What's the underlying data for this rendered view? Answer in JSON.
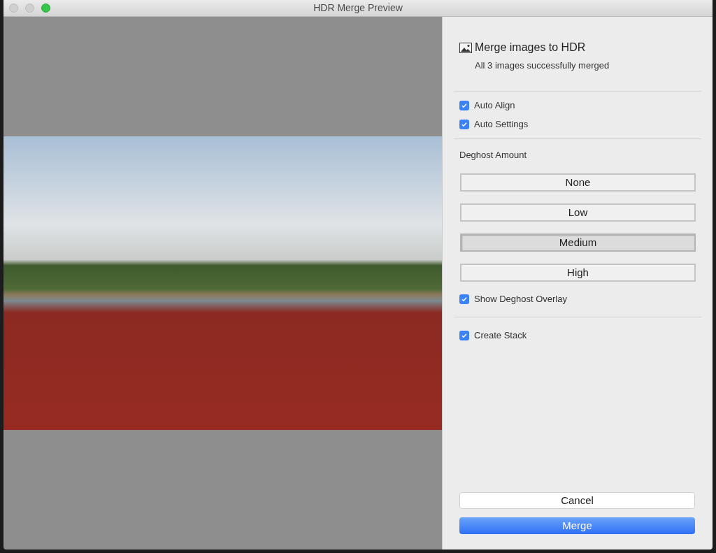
{
  "window": {
    "title": "HDR Merge Preview"
  },
  "panel": {
    "title": "Merge images to HDR",
    "subtitle": "All 3 images successfully merged",
    "align_options": [
      {
        "label": "Auto Align",
        "checked": true
      },
      {
        "label": "Auto Settings",
        "checked": true
      }
    ],
    "deghost": {
      "label": "Deghost Amount",
      "levels": [
        {
          "label": "None",
          "selected": false
        },
        {
          "label": "Low",
          "selected": false
        },
        {
          "label": "Medium",
          "selected": true
        },
        {
          "label": "High",
          "selected": false
        }
      ],
      "overlay": {
        "label": "Show Deghost Overlay",
        "checked": true
      }
    },
    "stack": {
      "label": "Create Stack",
      "checked": true
    },
    "buttons": [
      {
        "label": "Cancel",
        "kind": "secondary"
      },
      {
        "label": "Merge",
        "kind": "primary"
      }
    ]
  }
}
